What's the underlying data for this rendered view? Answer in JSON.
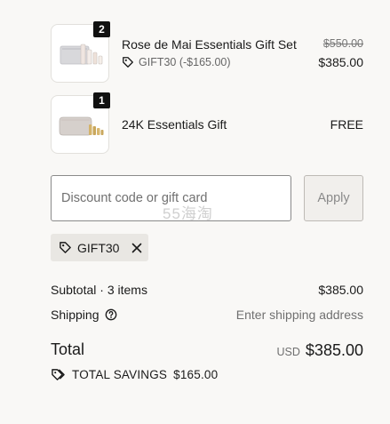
{
  "line_items": [
    {
      "quantity": "2",
      "name": "Rose de Mai Essentials Gift Set",
      "original_price": "$550.00",
      "discount": "GIFT30 (-$165.00)",
      "price": "$385.00"
    },
    {
      "quantity": "1",
      "name": "24K Essentials Gift",
      "price": "FREE"
    }
  ],
  "discount": {
    "placeholder": "Discount code or gift card",
    "value": "",
    "apply_label": "Apply",
    "applied_code": "GIFT30"
  },
  "watermark": "55海淘",
  "summary": {
    "subtotal_label": "Subtotal · 3 items",
    "subtotal_value": "$385.00",
    "shipping_label": "Shipping",
    "shipping_value": "Enter shipping address",
    "total_label": "Total",
    "currency": "USD",
    "total_value": "$385.00",
    "savings_label": "TOTAL SAVINGS",
    "savings_value": "$165.00"
  },
  "icons": {
    "discount_tag": "tag-icon",
    "remove": "close-icon",
    "help": "question-circle-icon",
    "savings": "tags-icon"
  }
}
